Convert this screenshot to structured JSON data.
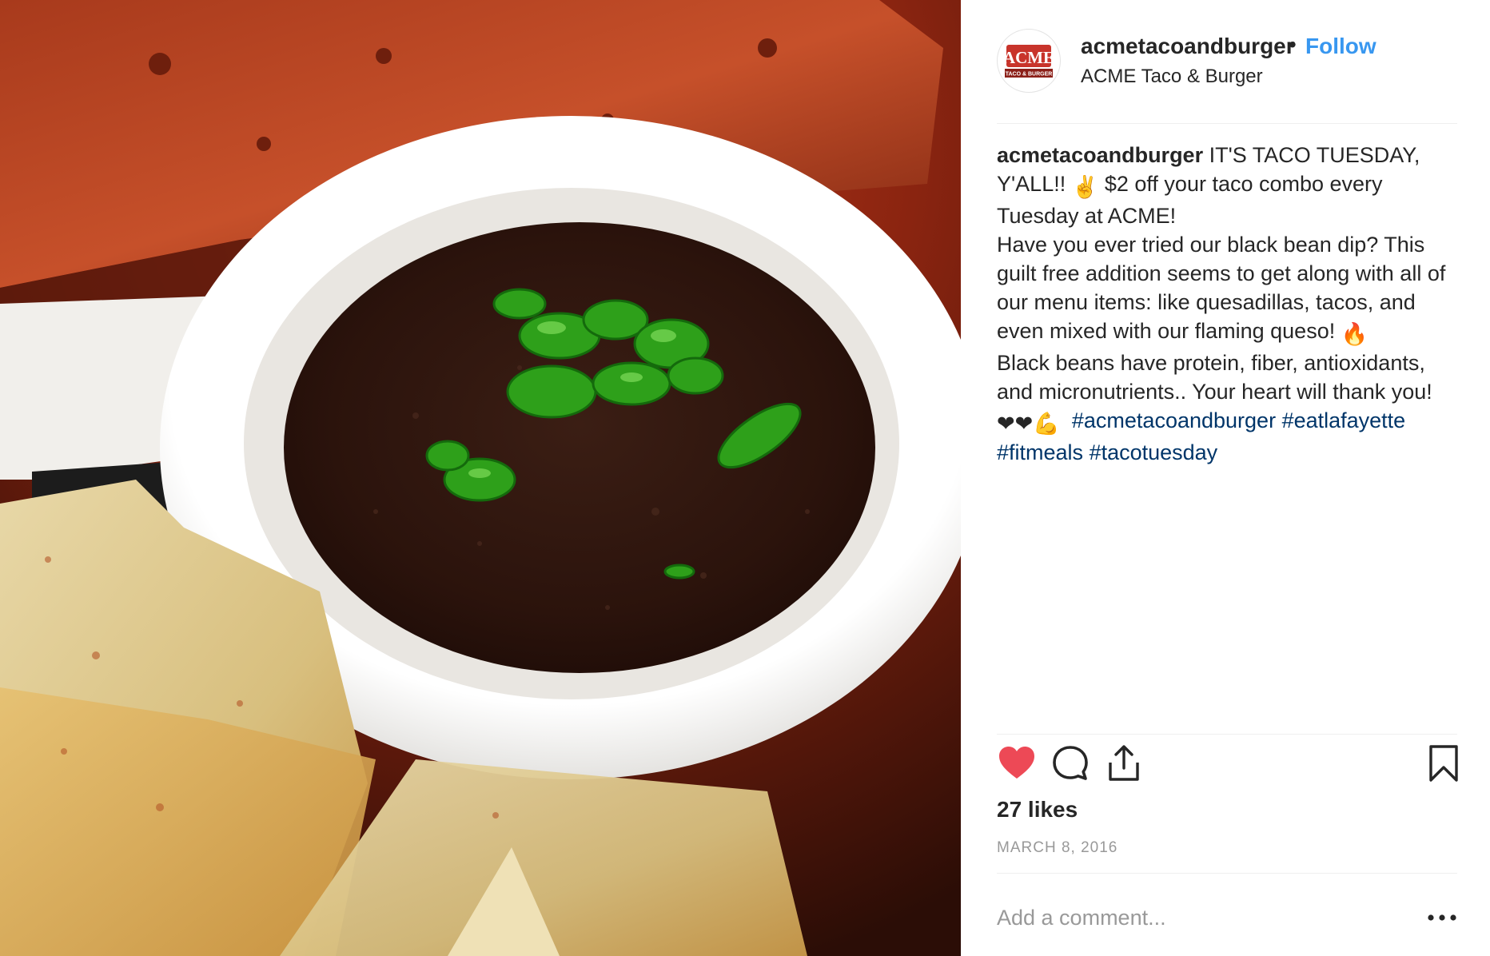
{
  "post": {
    "username": "acmetacoandburger",
    "separator": "•",
    "follow_label": "Follow",
    "location": "ACME Taco & Burger",
    "avatar": {
      "logo_text": "ACME",
      "logo_subtext": "TACO & BURGER"
    }
  },
  "caption": {
    "username": "acmetacoandburger",
    "line1": " IT'S TACO TUESDAY, Y'ALL!!",
    "emoji_peace": "✌️",
    "line1b": "  $2 off your taco combo every Tuesday at ACME!",
    "para2a": "Have you ever tried our black bean dip? This guilt free addition seems to get along with all of our menu items: like quesadillas, tacos, and even mixed with our flaming queso!",
    "emoji_fire": "🔥",
    "para3a": "Black beans have protein, fiber, antioxidants, and micronutrients.. Your heart will thank you!",
    "emoji_hearts": "❤❤💪",
    "hashtags": [
      "#acmetacoandburger",
      "#eatlafayette",
      "#fitmeals",
      "#tacotuesday"
    ]
  },
  "actions": {
    "like_icon": "heart-filled-icon",
    "comment_icon": "comment-bubble-icon",
    "share_icon": "share-upload-icon",
    "save_icon": "bookmark-icon",
    "liked_color": "#ed4956"
  },
  "likes_label": "27 likes",
  "date_label": "MARCH 8, 2016",
  "comment": {
    "placeholder": "Add a comment...",
    "more_icon": "more-options-icon"
  },
  "colors": {
    "link": "#3897f0",
    "hashtag": "#003569",
    "muted": "#999999"
  }
}
